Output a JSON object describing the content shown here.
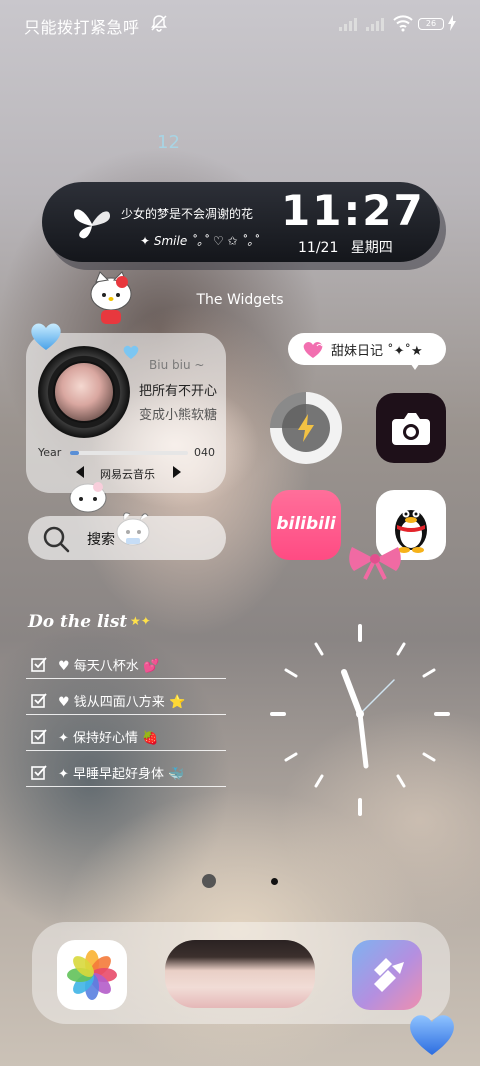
{
  "status_bar": {
    "carrier_text": "只能拨打紧急呼",
    "battery": "26",
    "icons": [
      "bell-off-icon",
      "signal-icon",
      "signal-icon",
      "wifi-icon",
      "battery-icon",
      "charging-icon"
    ]
  },
  "top_widget": {
    "small_number": "12",
    "motto": "少女的梦是不会凋谢的花",
    "smile_line": "✦ Smile ˚｡˚ ♡ ✩ ˚｡˚",
    "time": "11:27",
    "date": "11/21",
    "weekday": "星期四"
  },
  "widgets_title": "The Widgets",
  "music": {
    "line1": "Biu biu ~",
    "line2": "把所有不开心",
    "line3": "变成小熊软糖",
    "year_label": "Year",
    "number": "040",
    "app_name": "网易云音乐",
    "progress": 0.08
  },
  "search": {
    "label": "搜索"
  },
  "diary": {
    "text": "甜妹日记 ˚✦˚★"
  },
  "apps": {
    "bili_text": "bilibili"
  },
  "todo": {
    "title": "Do the list",
    "stars": "★✦",
    "items": [
      {
        "text": "每天八杯水",
        "emoji": "💕"
      },
      {
        "text": "钱从四面八方来",
        "emoji": "⭐"
      },
      {
        "text": "保持好心情",
        "emoji": "🍓"
      },
      {
        "text": "早睡早起好身体",
        "emoji": "🐳"
      }
    ]
  },
  "colors": {
    "clock_pill": "#1b1d22",
    "bili_pink": "#ff5a8c",
    "camera_bg": "#1e1019",
    "accent_blue": "#5a8fd6"
  }
}
